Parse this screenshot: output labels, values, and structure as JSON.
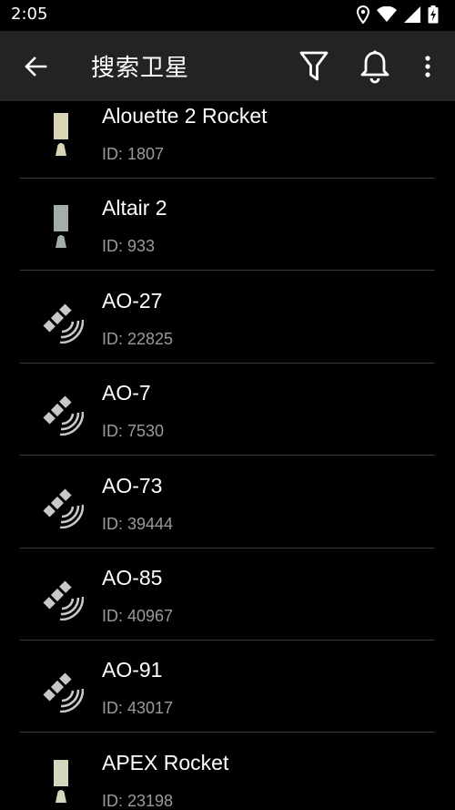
{
  "status_bar": {
    "time": "2:05",
    "icons": [
      "location-icon",
      "wifi-icon",
      "signal-icon",
      "battery-charging-icon"
    ]
  },
  "app_bar": {
    "title": "搜索卫星",
    "back_icon": "arrow-left-icon",
    "actions": [
      "filter-icon",
      "bell-icon",
      "more-vert-icon"
    ]
  },
  "satellites": [
    {
      "name": "Alouette 2 Rocket",
      "id_text": "ID: 1807",
      "icon": "rocket-icon",
      "icon_color": "#d9d4b4"
    },
    {
      "name": "Altair 2",
      "id_text": "ID: 933",
      "icon": "rocket-icon",
      "icon_color": "#a3aeab"
    },
    {
      "name": "AO-27",
      "id_text": "ID: 22825",
      "icon": "satellite-icon",
      "icon_color": "#c8c8c8"
    },
    {
      "name": "AO-7",
      "id_text": "ID: 7530",
      "icon": "satellite-icon",
      "icon_color": "#c8c8c8"
    },
    {
      "name": "AO-73",
      "id_text": "ID: 39444",
      "icon": "satellite-icon",
      "icon_color": "#c8c8c8"
    },
    {
      "name": "AO-85",
      "id_text": "ID: 40967",
      "icon": "satellite-icon",
      "icon_color": "#c8c8c8"
    },
    {
      "name": "AO-91",
      "id_text": "ID: 43017",
      "icon": "satellite-icon",
      "icon_color": "#c8c8c8"
    },
    {
      "name": "APEX Rocket",
      "id_text": "ID: 23198",
      "icon": "rocket-icon",
      "icon_color": "#d2d7be"
    }
  ],
  "colors": {
    "background": "#000000",
    "app_bar": "#232323",
    "divider": "#3a3a3a",
    "secondary_text": "#9a9a9a"
  }
}
